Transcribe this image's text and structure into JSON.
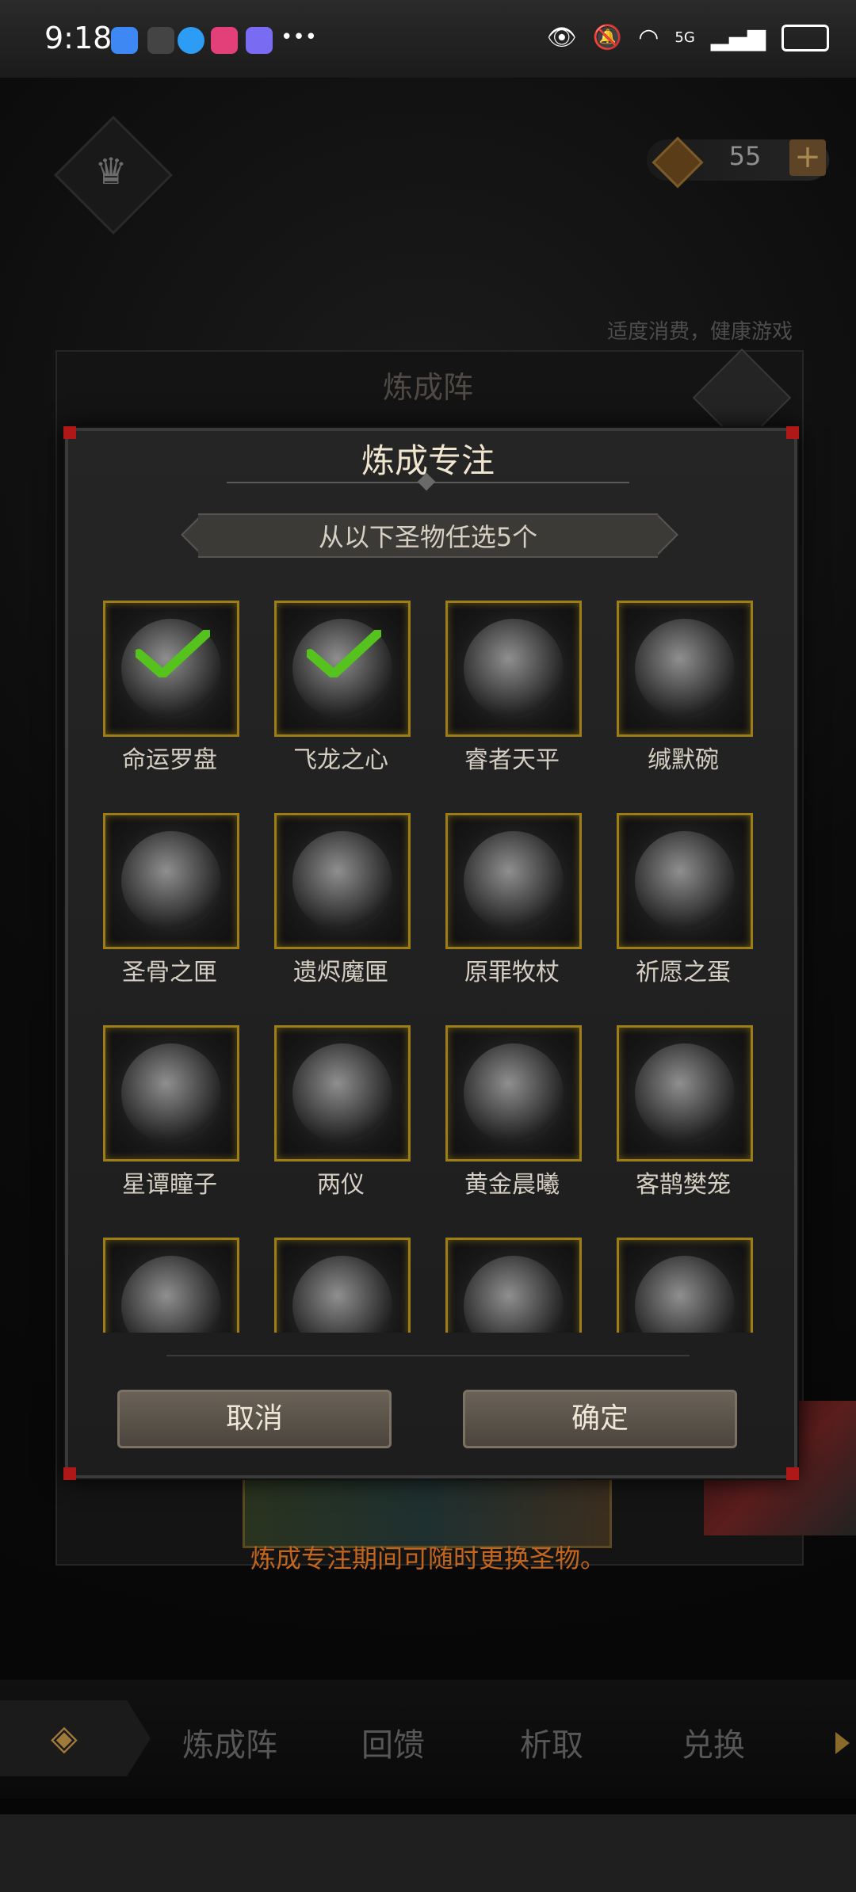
{
  "status_bar": {
    "time": "9:18",
    "network": "5G"
  },
  "top": {
    "currency_value": "55",
    "add_label": "+",
    "notice": "适度消费，健康游戏"
  },
  "background_panel": {
    "title": "炼成阵"
  },
  "modal": {
    "title": "炼成专注",
    "subtitle": "从以下圣物任选5个",
    "relics": [
      {
        "name": "命运罗盘",
        "selected": true
      },
      {
        "name": "飞龙之心",
        "selected": true
      },
      {
        "name": "睿者天平",
        "selected": false
      },
      {
        "name": "缄默碗",
        "selected": false
      },
      {
        "name": "圣骨之匣",
        "selected": false
      },
      {
        "name": "遗烬魔匣",
        "selected": false
      },
      {
        "name": "原罪牧杖",
        "selected": false
      },
      {
        "name": "祈愿之蛋",
        "selected": false
      },
      {
        "name": "星谭瞳子",
        "selected": false
      },
      {
        "name": "两仪",
        "selected": false
      },
      {
        "name": "黄金晨曦",
        "selected": false
      },
      {
        "name": "客鹊樊笼",
        "selected": false
      },
      {
        "name": "",
        "selected": false
      },
      {
        "name": "",
        "selected": false
      },
      {
        "name": "",
        "selected": false
      },
      {
        "name": "",
        "selected": false
      }
    ],
    "cancel_label": "取消",
    "confirm_label": "确定"
  },
  "bottom_message": "炼成专注期间可随时更换圣物。",
  "tabs": [
    "炼成阵",
    "回馈",
    "析取",
    "兑换"
  ],
  "colors": {
    "frame_gold": "#9c7d17",
    "check_green": "#56c21e",
    "accent_orange": "#c2661d"
  }
}
